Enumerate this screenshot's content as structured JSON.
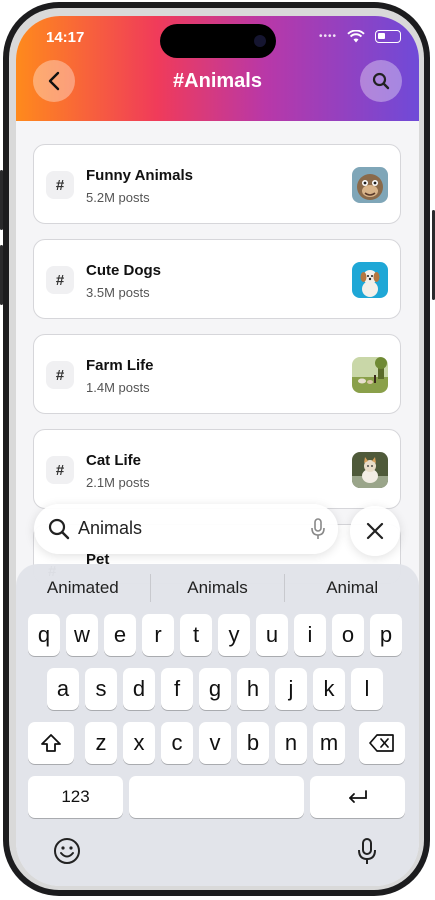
{
  "status": {
    "time": "14:17",
    "signal_text": "••••"
  },
  "header": {
    "title": "#Animals"
  },
  "topics": [
    {
      "name": "Funny Animals",
      "posts": "5.2M posts",
      "hash": "#",
      "thumb": "monkey"
    },
    {
      "name": "Cute Dogs",
      "posts": "3.5M posts",
      "hash": "#",
      "thumb": "dog"
    },
    {
      "name": "Farm Life",
      "posts": "1.4M posts",
      "hash": "#",
      "thumb": "farm"
    },
    {
      "name": "Cat Life",
      "posts": "2.1M posts",
      "hash": "#",
      "thumb": "cat"
    }
  ],
  "partial_topic": {
    "name": "Pet",
    "hash": "#"
  },
  "search": {
    "value": "Animals"
  },
  "keyboard": {
    "suggestions": [
      "Animated",
      "Animals",
      "Animal"
    ],
    "row1": [
      "q",
      "w",
      "e",
      "r",
      "t",
      "y",
      "u",
      "i",
      "o",
      "p"
    ],
    "row2": [
      "a",
      "s",
      "d",
      "f",
      "g",
      "h",
      "j",
      "k",
      "l"
    ],
    "row3": [
      "z",
      "x",
      "c",
      "v",
      "b",
      "n",
      "m"
    ],
    "numbers_label": "123"
  },
  "colors": {
    "gradient_start": "#ff8a1c",
    "gradient_mid": "#b838a8",
    "gradient_end": "#6f4ad8"
  }
}
